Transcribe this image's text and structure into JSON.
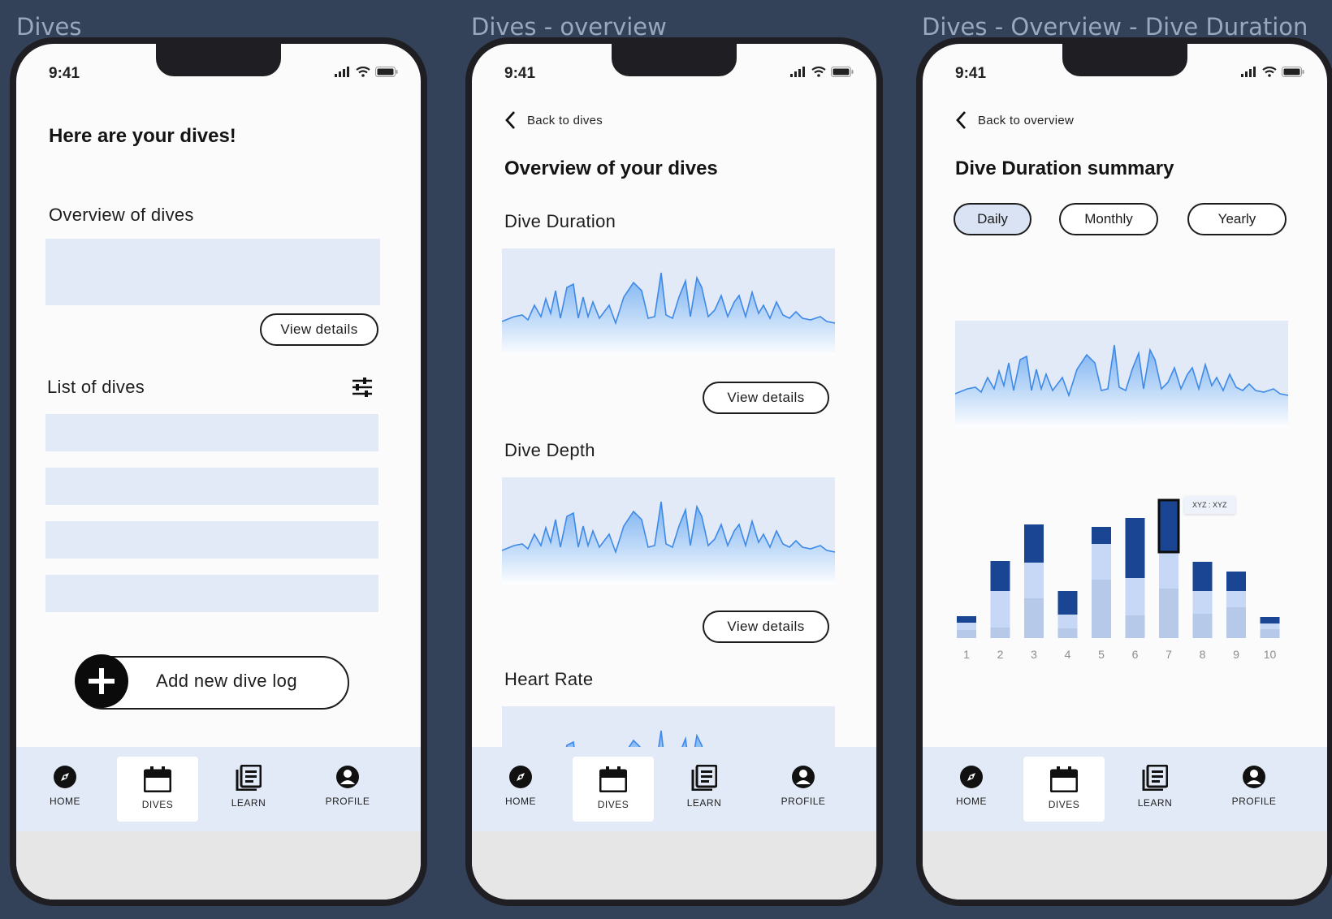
{
  "frames": [
    {
      "label": "Dives"
    },
    {
      "label": "Dives - overview"
    },
    {
      "label": "Dives - Overview - Dive Duration"
    }
  ],
  "status": {
    "time": "9:41"
  },
  "nav": {
    "items": [
      {
        "label": "HOME",
        "icon": "compass-icon"
      },
      {
        "label": "DIVES",
        "icon": "calendar-icon"
      },
      {
        "label": "LEARN",
        "icon": "book-icon"
      },
      {
        "label": "PROFILE",
        "icon": "user-circle-icon"
      }
    ],
    "active": "DIVES"
  },
  "dives": {
    "title": "Here are your dives!",
    "overview_heading": "Overview of dives",
    "view_details": "View details",
    "list_heading": "List of dives",
    "add_button": "Add new dive log"
  },
  "overview": {
    "back": "Back to dives",
    "title": "Overview of your dives",
    "sections": [
      {
        "heading": "Dive Duration",
        "button": "View details"
      },
      {
        "heading": "Dive Depth",
        "button": "View details"
      },
      {
        "heading": "Heart Rate"
      }
    ]
  },
  "duration": {
    "back": "Back to overview",
    "title": "Dive Duration summary",
    "tabs": [
      "Daily",
      "Monthly",
      "Yearly"
    ],
    "active_tab": "Daily",
    "tooltip": "XYZ : XYZ"
  },
  "colors": {
    "accent_dark": "#1a4592",
    "accent_light": "#c7d8f6",
    "accent_mid": "#b7c9e8",
    "wave_line": "#3d8ae8",
    "placeholder": "#e2e9f7"
  },
  "chart_data": {
    "type": "bar",
    "stacked": true,
    "categories": [
      "1",
      "2",
      "3",
      "4",
      "5",
      "6",
      "7",
      "8",
      "9",
      "10"
    ],
    "series": [
      {
        "values": [
          10,
          13,
          49,
          12,
          72,
          28,
          61,
          30,
          38,
          11
        ]
      },
      {
        "values": [
          9,
          45,
          44,
          17,
          44,
          46,
          45,
          28,
          20,
          7
        ]
      },
      {
        "values": [
          8,
          37,
          47,
          29,
          21,
          74,
          64,
          36,
          24,
          8
        ]
      }
    ],
    "highlight_index": 6
  }
}
